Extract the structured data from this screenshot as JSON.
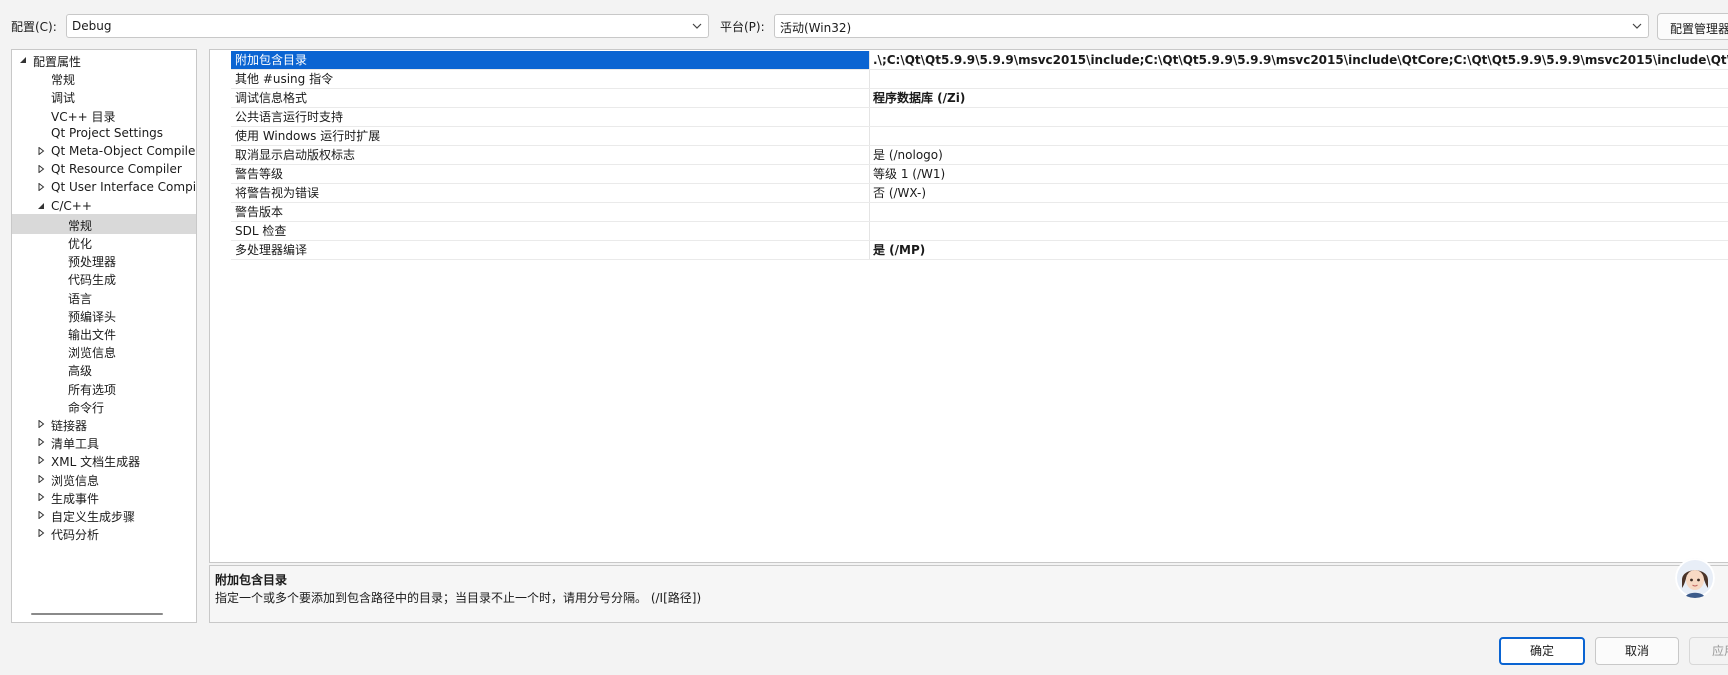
{
  "top": {
    "config_label": "配置(C):",
    "config_value": "Debug",
    "platform_label": "平台(P):",
    "platform_value": "活动(Win32)",
    "config_manager_button": "配置管理器"
  },
  "tree": {
    "items": [
      {
        "label": "配置属性",
        "state": "expanded"
      },
      {
        "label": "常规"
      },
      {
        "label": "调试"
      },
      {
        "label": "VC++ 目录"
      },
      {
        "label": "Qt Project Settings"
      },
      {
        "label": "Qt Meta-Object Compiler",
        "state": "collapsed"
      },
      {
        "label": "Qt Resource Compiler",
        "state": "collapsed"
      },
      {
        "label": "Qt User Interface Compiler",
        "state": "collapsed"
      },
      {
        "label": "C/C++",
        "state": "expanded"
      },
      {
        "label": "常规",
        "selected": true
      },
      {
        "label": "优化"
      },
      {
        "label": "预处理器"
      },
      {
        "label": "代码生成"
      },
      {
        "label": "语言"
      },
      {
        "label": "预编译头"
      },
      {
        "label": "输出文件"
      },
      {
        "label": "浏览信息"
      },
      {
        "label": "高级"
      },
      {
        "label": "所有选项"
      },
      {
        "label": "命令行"
      },
      {
        "label": "链接器",
        "state": "collapsed"
      },
      {
        "label": "清单工具",
        "state": "collapsed"
      },
      {
        "label": "XML 文档生成器",
        "state": "collapsed"
      },
      {
        "label": "浏览信息",
        "state": "collapsed"
      },
      {
        "label": "生成事件",
        "state": "collapsed"
      },
      {
        "label": "自定义生成步骤",
        "state": "collapsed"
      },
      {
        "label": "代码分析",
        "state": "collapsed"
      }
    ]
  },
  "properties": [
    {
      "name": "附加包含目录",
      "value": ".\\;C:\\Qt\\Qt5.9.9\\5.9.9\\msvc2015\\include;C:\\Qt\\Qt5.9.9\\5.9.9\\msvc2015\\include\\QtCore;C:\\Qt\\Qt5.9.9\\5.9.9\\msvc2015\\include\\QtWidgets;soem",
      "bold": true,
      "selected": true
    },
    {
      "name": "其他 #using 指令",
      "value": ""
    },
    {
      "name": "调试信息格式",
      "value": "程序数据库 (/Zi)",
      "bold": true
    },
    {
      "name": "公共语言运行时支持",
      "value": ""
    },
    {
      "name": "使用 Windows 运行时扩展",
      "value": ""
    },
    {
      "name": "取消显示启动版权标志",
      "value": "是 (/nologo)"
    },
    {
      "name": "警告等级",
      "value": "等级 1 (/W1)"
    },
    {
      "name": "将警告视为错误",
      "value": "否 (/WX-)"
    },
    {
      "name": "警告版本",
      "value": ""
    },
    {
      "name": "SDL 检查",
      "value": ""
    },
    {
      "name": "多处理器编译",
      "value": "是 (/MP)",
      "bold": true
    }
  ],
  "description": {
    "title": "附加包含目录",
    "text": "指定一个或多个要添加到包含路径中的目录；当目录不止一个时，请用分号分隔。      (/I[路径])"
  },
  "buttons": {
    "ok": "确定",
    "cancel": "取消",
    "apply": "应用"
  },
  "colors": {
    "selection": "#0a64d2",
    "tree_selected": "#d9d9d9"
  }
}
